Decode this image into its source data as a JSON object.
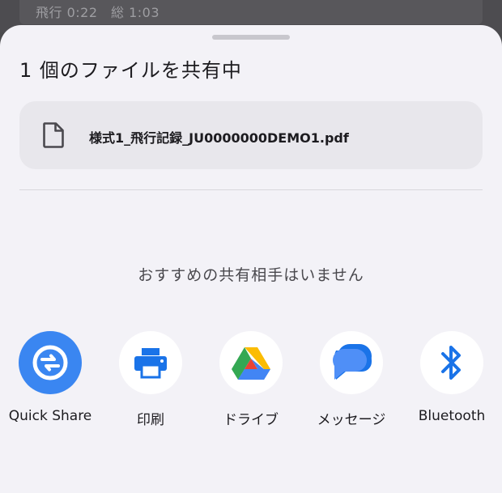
{
  "background": {
    "status_text": "飛行 0:22　総 1:03"
  },
  "sheet": {
    "title": "1 個のファイルを共有中",
    "file": {
      "name": "様式1_飛行記録_JU0000000DEMO1.pdf",
      "icon": "document-icon"
    },
    "empty_message": "おすすめの共有相手はいません",
    "targets": [
      {
        "label": "Quick Share",
        "icon": "quick-share-icon",
        "color": "#3a86f1"
      },
      {
        "label": "印刷",
        "icon": "printer-icon",
        "color": "#1a73e8"
      },
      {
        "label": "ドライブ",
        "icon": "google-drive-icon",
        "color": "#34a853"
      },
      {
        "label": "メッセージ",
        "icon": "messages-icon",
        "color": "#1a73e8"
      },
      {
        "label": "Bluetooth",
        "icon": "bluetooth-icon",
        "color": "#1a73e8"
      }
    ]
  }
}
